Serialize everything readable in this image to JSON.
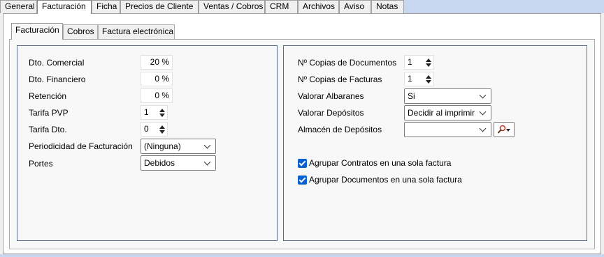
{
  "top_tabs": [
    "General",
    "Facturación",
    "Ficha",
    "Precios de Cliente",
    "Ventas / Cobros",
    "CRM",
    "Archivos",
    "Aviso",
    "Notas"
  ],
  "active_top_tab": "Facturación",
  "sub_tabs": [
    "Facturación",
    "Cobros",
    "Factura electrónica"
  ],
  "active_sub_tab": "Facturación",
  "left": {
    "dto_comercial": {
      "label": "Dto. Comercial",
      "value": "20 %"
    },
    "dto_financiero": {
      "label": "Dto. Financiero",
      "value": "0 %"
    },
    "retencion": {
      "label": "Retención",
      "value": "0 %"
    },
    "tarifa_pvp": {
      "label": "Tarifa PVP",
      "value": "1"
    },
    "tarifa_dto": {
      "label": "Tarifa Dto.",
      "value": "0"
    },
    "periodicidad": {
      "label": "Periodicidad de Facturación",
      "value": "(Ninguna)"
    },
    "portes": {
      "label": "Portes",
      "value": "Debidos"
    }
  },
  "right": {
    "copias_documentos": {
      "label": "Nº Copias de Documentos",
      "value": "1"
    },
    "copias_facturas": {
      "label": "Nº Copias de Facturas",
      "value": "1"
    },
    "valorar_albaranes": {
      "label": "Valorar Albaranes",
      "value": "Si"
    },
    "valorar_depositos": {
      "label": "Valorar Depósitos",
      "value": "Decidir al imprimir"
    },
    "almacen_depositos": {
      "label": "Almacén de Depósitos",
      "value": ""
    },
    "agrupar_contratos": {
      "label": "Agrupar Contratos en una sola factura",
      "checked": true
    },
    "agrupar_documentos": {
      "label": "Agrupar Documentos en una sola factura",
      "checked": true
    }
  },
  "colors": {
    "tab_strip": "#c9d7ee",
    "group_border": "#5b6f99",
    "checkbox": "#0a5fd3"
  },
  "icons": {
    "lookup": "magnifier-icon",
    "dropdown": "chevron-down-icon",
    "spin": "spin-arrows-icon"
  }
}
